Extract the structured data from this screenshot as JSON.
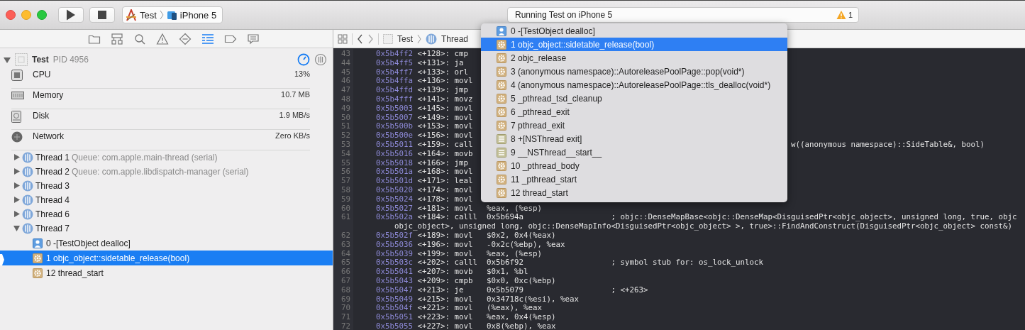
{
  "toolbar": {
    "scheme": {
      "target": "Test",
      "device": "iPhone 5"
    },
    "activity": {
      "status": "Running Test on iPhone 5",
      "warnings": "1"
    }
  },
  "navigator": {
    "tabs": [
      {
        "kind": "folder",
        "selected": false
      },
      {
        "kind": "hierarchy",
        "selected": false
      },
      {
        "kind": "search",
        "selected": false
      },
      {
        "kind": "warning",
        "selected": false
      },
      {
        "kind": "test",
        "selected": false
      },
      {
        "kind": "debug",
        "selected": true
      },
      {
        "kind": "breakpoint",
        "selected": false
      },
      {
        "kind": "report",
        "selected": false
      }
    ],
    "process": {
      "name": "Test",
      "pid": "PID 4956",
      "expanded": true
    },
    "gauges": [
      {
        "kind": "cpu",
        "label": "CPU",
        "value": "13%"
      },
      {
        "kind": "memory",
        "label": "Memory",
        "value": "10.7 MB"
      },
      {
        "kind": "disk",
        "label": "Disk",
        "value": "1.9 MB/s"
      },
      {
        "kind": "network",
        "label": "Network",
        "value": "Zero KB/s"
      }
    ],
    "threads": [
      {
        "label": "Thread 1",
        "queue": "Queue: com.apple.main-thread (serial)",
        "expanded": false
      },
      {
        "label": "Thread 2",
        "queue": "Queue: com.apple.libdispatch-manager (serial)",
        "expanded": false
      },
      {
        "label": "Thread 3",
        "expanded": false
      },
      {
        "label": "Thread 4",
        "expanded": false
      },
      {
        "label": "Thread 6",
        "expanded": false
      },
      {
        "label": "Thread 7",
        "expanded": true,
        "children": [
          {
            "label": "0 -[TestObject dealloc]",
            "kind": "user",
            "selected": false
          },
          {
            "label": "1 objc_object::sidetable_release(bool)",
            "kind": "system",
            "selected": true
          },
          {
            "label": "12 thread_start",
            "kind": "system",
            "selected": false
          }
        ]
      }
    ]
  },
  "jump_bar": {
    "items": [
      "Test",
      "Thread"
    ]
  },
  "editor": {
    "lines": [
      {
        "number": "43",
        "address": "0x5b4ff2",
        "offset": "<+128>:",
        "mnemonic": "cmp"
      },
      {
        "number": "44",
        "address": "0x5b4ff5",
        "offset": "<+131>:",
        "mnemonic": "ja"
      },
      {
        "number": "45",
        "address": "0x5b4ff7",
        "offset": "<+133>:",
        "mnemonic": "orl"
      },
      {
        "number": "46",
        "address": "0x5b4ffa",
        "offset": "<+136>:",
        "mnemonic": "movl"
      },
      {
        "number": "47",
        "address": "0x5b4ffd",
        "offset": "<+139>:",
        "mnemonic": "jmp"
      },
      {
        "number": "48",
        "address": "0x5b4fff",
        "offset": "<+141>:",
        "mnemonic": "movz"
      },
      {
        "number": "49",
        "address": "0x5b5003",
        "offset": "<+145>:",
        "mnemonic": "movl"
      },
      {
        "number": "50",
        "address": "0x5b5007",
        "offset": "<+149>:",
        "mnemonic": "movl"
      },
      {
        "number": "51",
        "address": "0x5b500b",
        "offset": "<+153>:",
        "mnemonic": "movl"
      },
      {
        "number": "52",
        "address": "0x5b500e",
        "offset": "<+156>:",
        "mnemonic": "movl"
      },
      {
        "number": "53",
        "address": "0x5b5011",
        "offset": "<+159>:",
        "mnemonic": "call",
        "comment_tail": "w((anonymous namespace)::SideTable&, bool)"
      },
      {
        "number": "54",
        "address": "0x5b5016",
        "offset": "<+164>:",
        "mnemonic": "movb"
      },
      {
        "number": "55",
        "address": "0x5b5018",
        "offset": "<+166>:",
        "mnemonic": "jmp"
      },
      {
        "number": "56",
        "address": "0x5b501a",
        "offset": "<+168>:",
        "mnemonic": "movl"
      },
      {
        "number": "57",
        "address": "0x5b501d",
        "offset": "<+171>:",
        "mnemonic": "leal"
      },
      {
        "number": "58",
        "address": "0x5b5020",
        "offset": "<+174>:",
        "mnemonic": "movl"
      },
      {
        "number": "59",
        "address": "0x5b5024",
        "offset": "<+178>:",
        "mnemonic": "movl"
      },
      {
        "number": "60",
        "address": "0x5b5027",
        "offset": "<+181>:",
        "mnemonic": "movl",
        "operands": "%eax, (%esp)"
      },
      {
        "number": "61",
        "address": "0x5b502a",
        "offset": "<+184>:",
        "mnemonic": "calll",
        "operands": "0x5b694a",
        "comment": "; objc::DenseMapBase<objc::DenseMap<DisguisedPtr<objc_object>, unsigned long, true, objc",
        "continuation": "objc_object>, unsigned long, objc::DenseMapInfo<DisguisedPtr<objc_object> >, true>::FindAndConstruct(DisguisedPtr<objc_object> const&)"
      },
      {
        "number": "62",
        "address": "0x5b502f",
        "offset": "<+189>:",
        "mnemonic": "movl",
        "operands": "$0x2, 0x4(%eax)"
      },
      {
        "number": "63",
        "address": "0x5b5036",
        "offset": "<+196>:",
        "mnemonic": "movl",
        "operands": "-0x2c(%ebp), %eax"
      },
      {
        "number": "64",
        "address": "0x5b5039",
        "offset": "<+199>:",
        "mnemonic": "movl",
        "operands": "%eax, (%esp)"
      },
      {
        "number": "65",
        "address": "0x5b503c",
        "offset": "<+202>:",
        "mnemonic": "calll",
        "operands": "0x5b6f92",
        "comment": "; symbol stub for: os_lock_unlock"
      },
      {
        "number": "66",
        "address": "0x5b5041",
        "offset": "<+207>:",
        "mnemonic": "movb",
        "operands": "$0x1, %bl"
      },
      {
        "number": "67",
        "address": "0x5b5043",
        "offset": "<+209>:",
        "mnemonic": "cmpb",
        "operands": "$0x0, 0xc(%ebp)"
      },
      {
        "number": "68",
        "address": "0x5b5047",
        "offset": "<+213>:",
        "mnemonic": "je",
        "operands": "0x5b5079",
        "comment": "; <+263>"
      },
      {
        "number": "69",
        "address": "0x5b5049",
        "offset": "<+215>:",
        "mnemonic": "movl",
        "operands": "0x34718c(%esi), %eax"
      },
      {
        "number": "70",
        "address": "0x5b504f",
        "offset": "<+221>:",
        "mnemonic": "movl",
        "operands": "(%eax), %eax"
      },
      {
        "number": "71",
        "address": "0x5b5051",
        "offset": "<+223>:",
        "mnemonic": "movl",
        "operands": "%eax, 0x4(%esp)"
      },
      {
        "number": "72",
        "address": "0x5b5055",
        "offset": "<+227>:",
        "mnemonic": "movl",
        "operands": "0x8(%ebp), %eax"
      }
    ]
  },
  "frame_popup": {
    "items": [
      {
        "label": "0 -[TestObject dealloc]",
        "kind": "user",
        "selected": false
      },
      {
        "label": "1 objc_object::sidetable_release(bool)",
        "kind": "system",
        "selected": true
      },
      {
        "label": "2 objc_release",
        "kind": "system",
        "selected": false
      },
      {
        "label": "3 (anonymous namespace)::AutoreleasePoolPage::pop(void*)",
        "kind": "system",
        "selected": false
      },
      {
        "label": "4 (anonymous namespace)::AutoreleasePoolPage::tls_dealloc(void*)",
        "kind": "system",
        "selected": false
      },
      {
        "label": "5 _pthread_tsd_cleanup",
        "kind": "system",
        "selected": false
      },
      {
        "label": "6 _pthread_exit",
        "kind": "system",
        "selected": false
      },
      {
        "label": "7 pthread_exit",
        "kind": "system",
        "selected": false
      },
      {
        "label": "8 +[NSThread exit]",
        "kind": "objc",
        "selected": false
      },
      {
        "label": "9 __NSThread__start__",
        "kind": "objc",
        "selected": false
      },
      {
        "label": "10 _pthread_body",
        "kind": "system",
        "selected": false
      },
      {
        "label": "11 _pthread_start",
        "kind": "system",
        "selected": false
      },
      {
        "label": "12 thread_start",
        "kind": "system",
        "selected": false
      }
    ]
  }
}
